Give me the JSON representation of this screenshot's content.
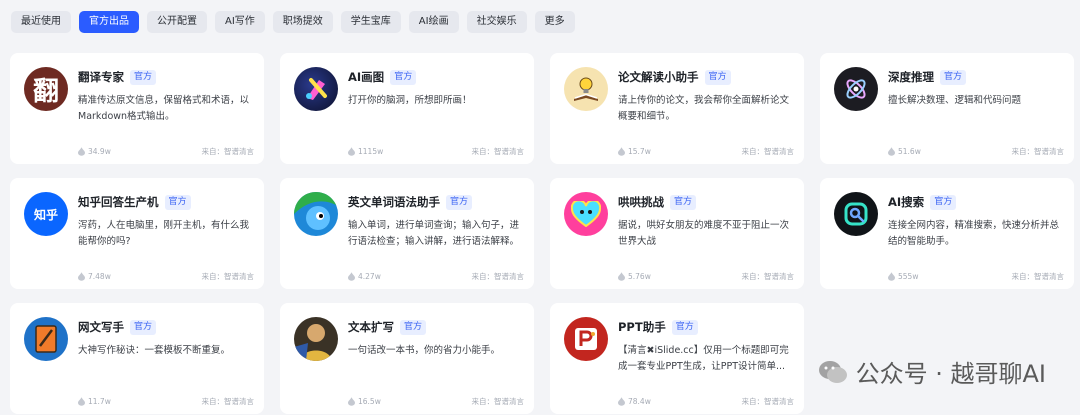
{
  "tabs": [
    "最近使用",
    "官方出品",
    "公开配置",
    "AI写作",
    "职场提效",
    "学生宝库",
    "AI绘画",
    "社交娱乐",
    "更多"
  ],
  "active_tab": "官方出品",
  "cards": [
    {
      "title": "翻译专家",
      "tag": "官方",
      "desc": "精准传达原文信息，保留格式和术语，以Markdown格式输出。",
      "views": "34.9w",
      "source": "来自：智谱清言",
      "icon": "translate-icon"
    },
    {
      "title": "AI画图",
      "tag": "官方",
      "desc": "打开你的脑洞，所想即所画！",
      "views": "1115w",
      "source": "来自：智谱清言",
      "icon": "ai-paint-icon"
    },
    {
      "title": "论文解读小助手",
      "tag": "官方",
      "desc": "请上传你的论文，我会帮你全面解析论文概要和细节。",
      "views": "15.7w",
      "source": "来自：智谱清言",
      "icon": "paper-reader-icon"
    },
    {
      "title": "深度推理",
      "tag": "官方",
      "desc": "擅长解决数理、逻辑和代码问题",
      "views": "51.6w",
      "source": "来自：智谱清言",
      "icon": "deep-reasoning-icon"
    },
    {
      "title": "知乎回答生产机",
      "tag": "官方",
      "desc": "泻药，人在电脑里，刚开主机，有什么我能帮你的吗?",
      "views": "7.48w",
      "source": "来自：智谱清言",
      "icon": "zhihu-icon",
      "icon_text": "知乎"
    },
    {
      "title": "英文单词语法助手",
      "tag": "官方",
      "desc": "输入单词，进行单词查询；输入句子，进行语法检查；输入讲解，进行语法解释。",
      "views": "4.27w",
      "source": "来自：智谱清言",
      "icon": "english-helper-icon"
    },
    {
      "title": "哄哄挑战",
      "tag": "官方",
      "desc": "据说，哄好女朋友的难度不亚于阻止一次世界大战",
      "views": "5.76w",
      "source": "来自：智谱清言",
      "icon": "heart-challenge-icon"
    },
    {
      "title": "AI搜索",
      "tag": "官方",
      "desc": "连接全网内容，精准搜索，快速分析并总结的智能助手。",
      "views": "555w",
      "source": "来自：智谱清言",
      "icon": "ai-search-icon"
    },
    {
      "title": "网文写手",
      "tag": "官方",
      "desc": "大神写作秘诀：一套模板不断重复。",
      "views": "11.7w",
      "source": "来自：智谱清言",
      "icon": "novel-writer-icon"
    },
    {
      "title": "文本扩写",
      "tag": "官方",
      "desc": "一句话改一本书，你的省力小能手。",
      "views": "16.5w",
      "source": "来自：智谱清言",
      "icon": "text-expand-icon"
    },
    {
      "title": "PPT助手",
      "tag": "官方",
      "desc": "【清言✖iSlide.cc】仅用一个标题即可完成一套专业PPT生成，让PPT设计简单...",
      "views": "78.4w",
      "source": "来自：智谱清言",
      "icon": "ppt-icon"
    }
  ],
  "watermark": "公众号 · 越哥聊AI",
  "colors": {
    "accent": "#2b5cff",
    "tag_bg": "#e8eeff",
    "tag_text": "#3a63f3",
    "page_bg": "#f3f4f7"
  }
}
